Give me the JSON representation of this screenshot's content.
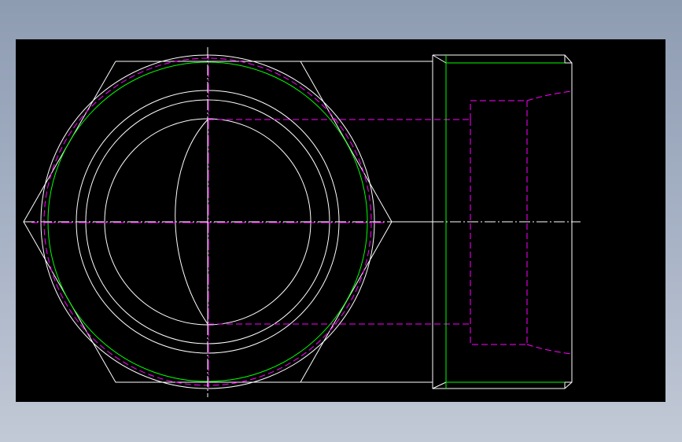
{
  "colors": {
    "background_top": "#8e9cb2",
    "background_bottom": "#c2c9d6",
    "viewport": "#000000",
    "object_line": "#ffffff",
    "thread_line": "#00ff00",
    "hidden_line": "#ff00ff",
    "center_line": "#ffffff"
  },
  "views": {
    "front": "hex-nut-front-view",
    "side": "nut-side-section-view"
  }
}
